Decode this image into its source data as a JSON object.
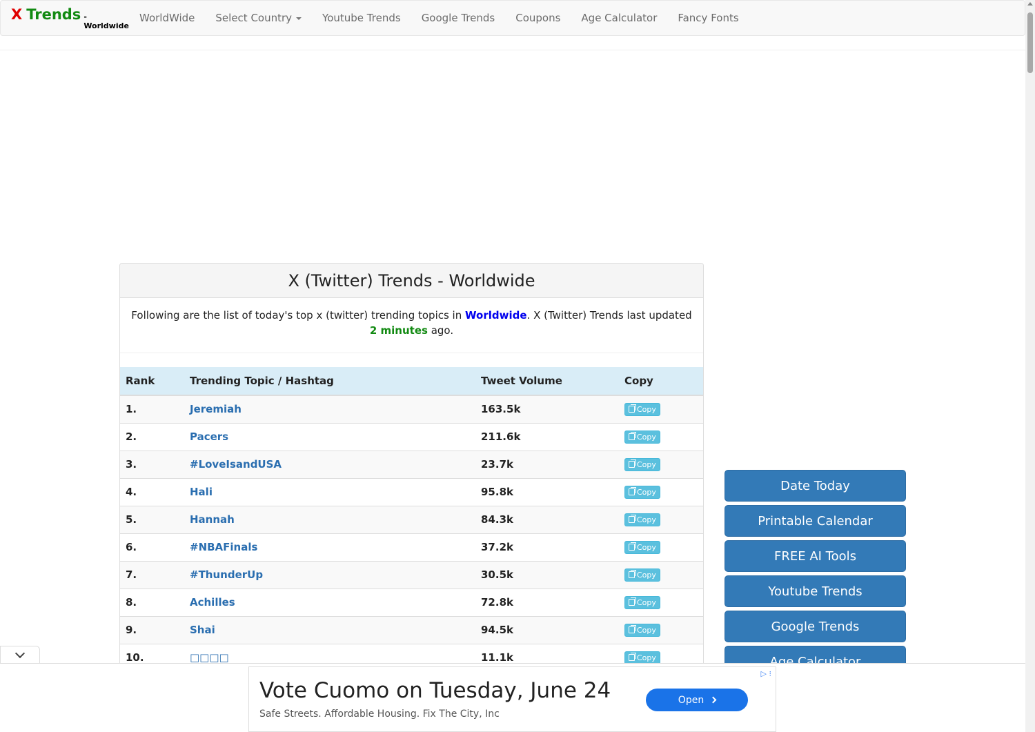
{
  "navbar": {
    "brand_x": "X",
    "brand_trends": "Trends",
    "brand_sub": "- Worldwide",
    "links": [
      "WorldWide",
      "Select Country",
      "Youtube Trends",
      "Google Trends",
      "Coupons",
      "Age Calculator",
      "Fancy Fonts"
    ]
  },
  "panel": {
    "title": "X (Twitter) Trends - Worldwide",
    "desc_before": "Following are the list of today's top x (twitter) trending topics in ",
    "desc_location": "Worldwide",
    "desc_middle": ". X (Twitter) Trends last updated ",
    "desc_ago": "2 minutes",
    "desc_after": " ago."
  },
  "table": {
    "headers": [
      "Rank",
      "Trending Topic / Hashtag",
      "Tweet Volume",
      "Copy"
    ],
    "copy_label": "Copy",
    "rows": [
      {
        "rank": "1.",
        "topic": "Jeremiah",
        "volume": "163.5k"
      },
      {
        "rank": "2.",
        "topic": "Pacers",
        "volume": "211.6k"
      },
      {
        "rank": "3.",
        "topic": "#LoveIsandUSA",
        "volume": "23.7k"
      },
      {
        "rank": "4.",
        "topic": "Hali",
        "volume": "95.8k"
      },
      {
        "rank": "5.",
        "topic": "Hannah",
        "volume": "84.3k"
      },
      {
        "rank": "6.",
        "topic": "#NBAFinals",
        "volume": "37.2k"
      },
      {
        "rank": "7.",
        "topic": "#ThunderUp",
        "volume": "30.5k"
      },
      {
        "rank": "8.",
        "topic": "Achilles",
        "volume": "72.8k"
      },
      {
        "rank": "9.",
        "topic": "Shai",
        "volume": "94.5k"
      },
      {
        "rank": "10.",
        "topic": "□□□□",
        "volume": "11.1k"
      }
    ]
  },
  "sidebar": {
    "buttons": [
      "Date Today",
      "Printable Calendar",
      "FREE AI Tools",
      "Youtube Trends",
      "Google Trends",
      "Age Calculator"
    ]
  },
  "ad": {
    "title": "Vote Cuomo on Tuesday, June 24",
    "subtitle": "Safe Streets. Affordable Housing. Fix The City, Inc",
    "button": "Open"
  }
}
